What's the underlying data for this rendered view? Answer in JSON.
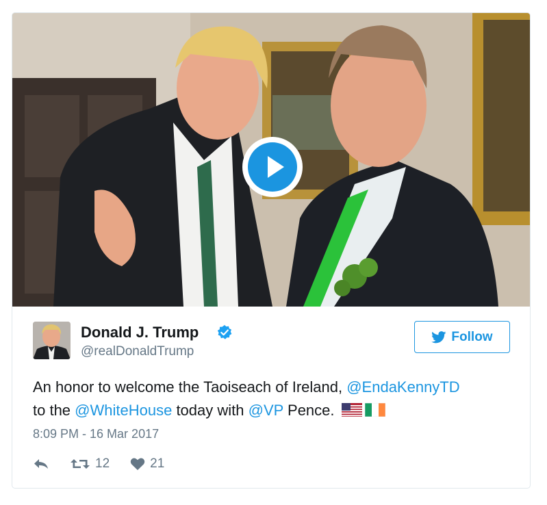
{
  "media": {
    "kind": "video-thumbnail",
    "play_icon": "play-icon"
  },
  "author": {
    "name": "Donald J. Trump",
    "handle": "@realDonaldTrump",
    "verified_icon": "verified-badge-icon"
  },
  "follow": {
    "label": "Follow",
    "icon": "twitter-bird-icon"
  },
  "tweet": {
    "seg1": "An honor to welcome the Taoiseach of Ireland, ",
    "mention1": "@EndaKennyTD",
    "seg2": "to the ",
    "mention2": "@WhiteHouse",
    "seg3": " today with ",
    "mention3": "@VP",
    "seg4": " Pence. ",
    "emoji": [
      "flag-us",
      "flag-ireland"
    ]
  },
  "timestamp": "8:09 PM - 16 Mar 2017",
  "actions": {
    "reply_icon": "reply-icon",
    "retweet_icon": "retweet-icon",
    "retweets": "12",
    "like_icon": "heart-icon",
    "likes": "21"
  },
  "colors": {
    "accent": "#1b95e0",
    "text": "#14171a",
    "muted": "#657786",
    "border": "#e1e8ed"
  }
}
